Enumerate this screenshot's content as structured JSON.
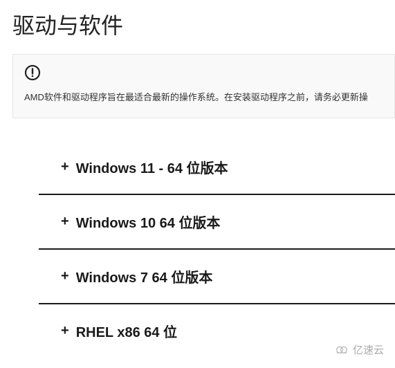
{
  "page_title": "驱动与软件",
  "notice": {
    "text": "AMD软件和驱动程序旨在最适合最新的操作系统。在安装驱动程序之前，请务必更新操"
  },
  "accordion": {
    "items": [
      {
        "label": "Windows 11 - 64 位版本"
      },
      {
        "label": "Windows 10 64 位版本"
      },
      {
        "label": "Windows 7 64 位版本"
      },
      {
        "label": "RHEL x86 64 位"
      }
    ]
  },
  "watermark": {
    "text": "亿速云"
  }
}
